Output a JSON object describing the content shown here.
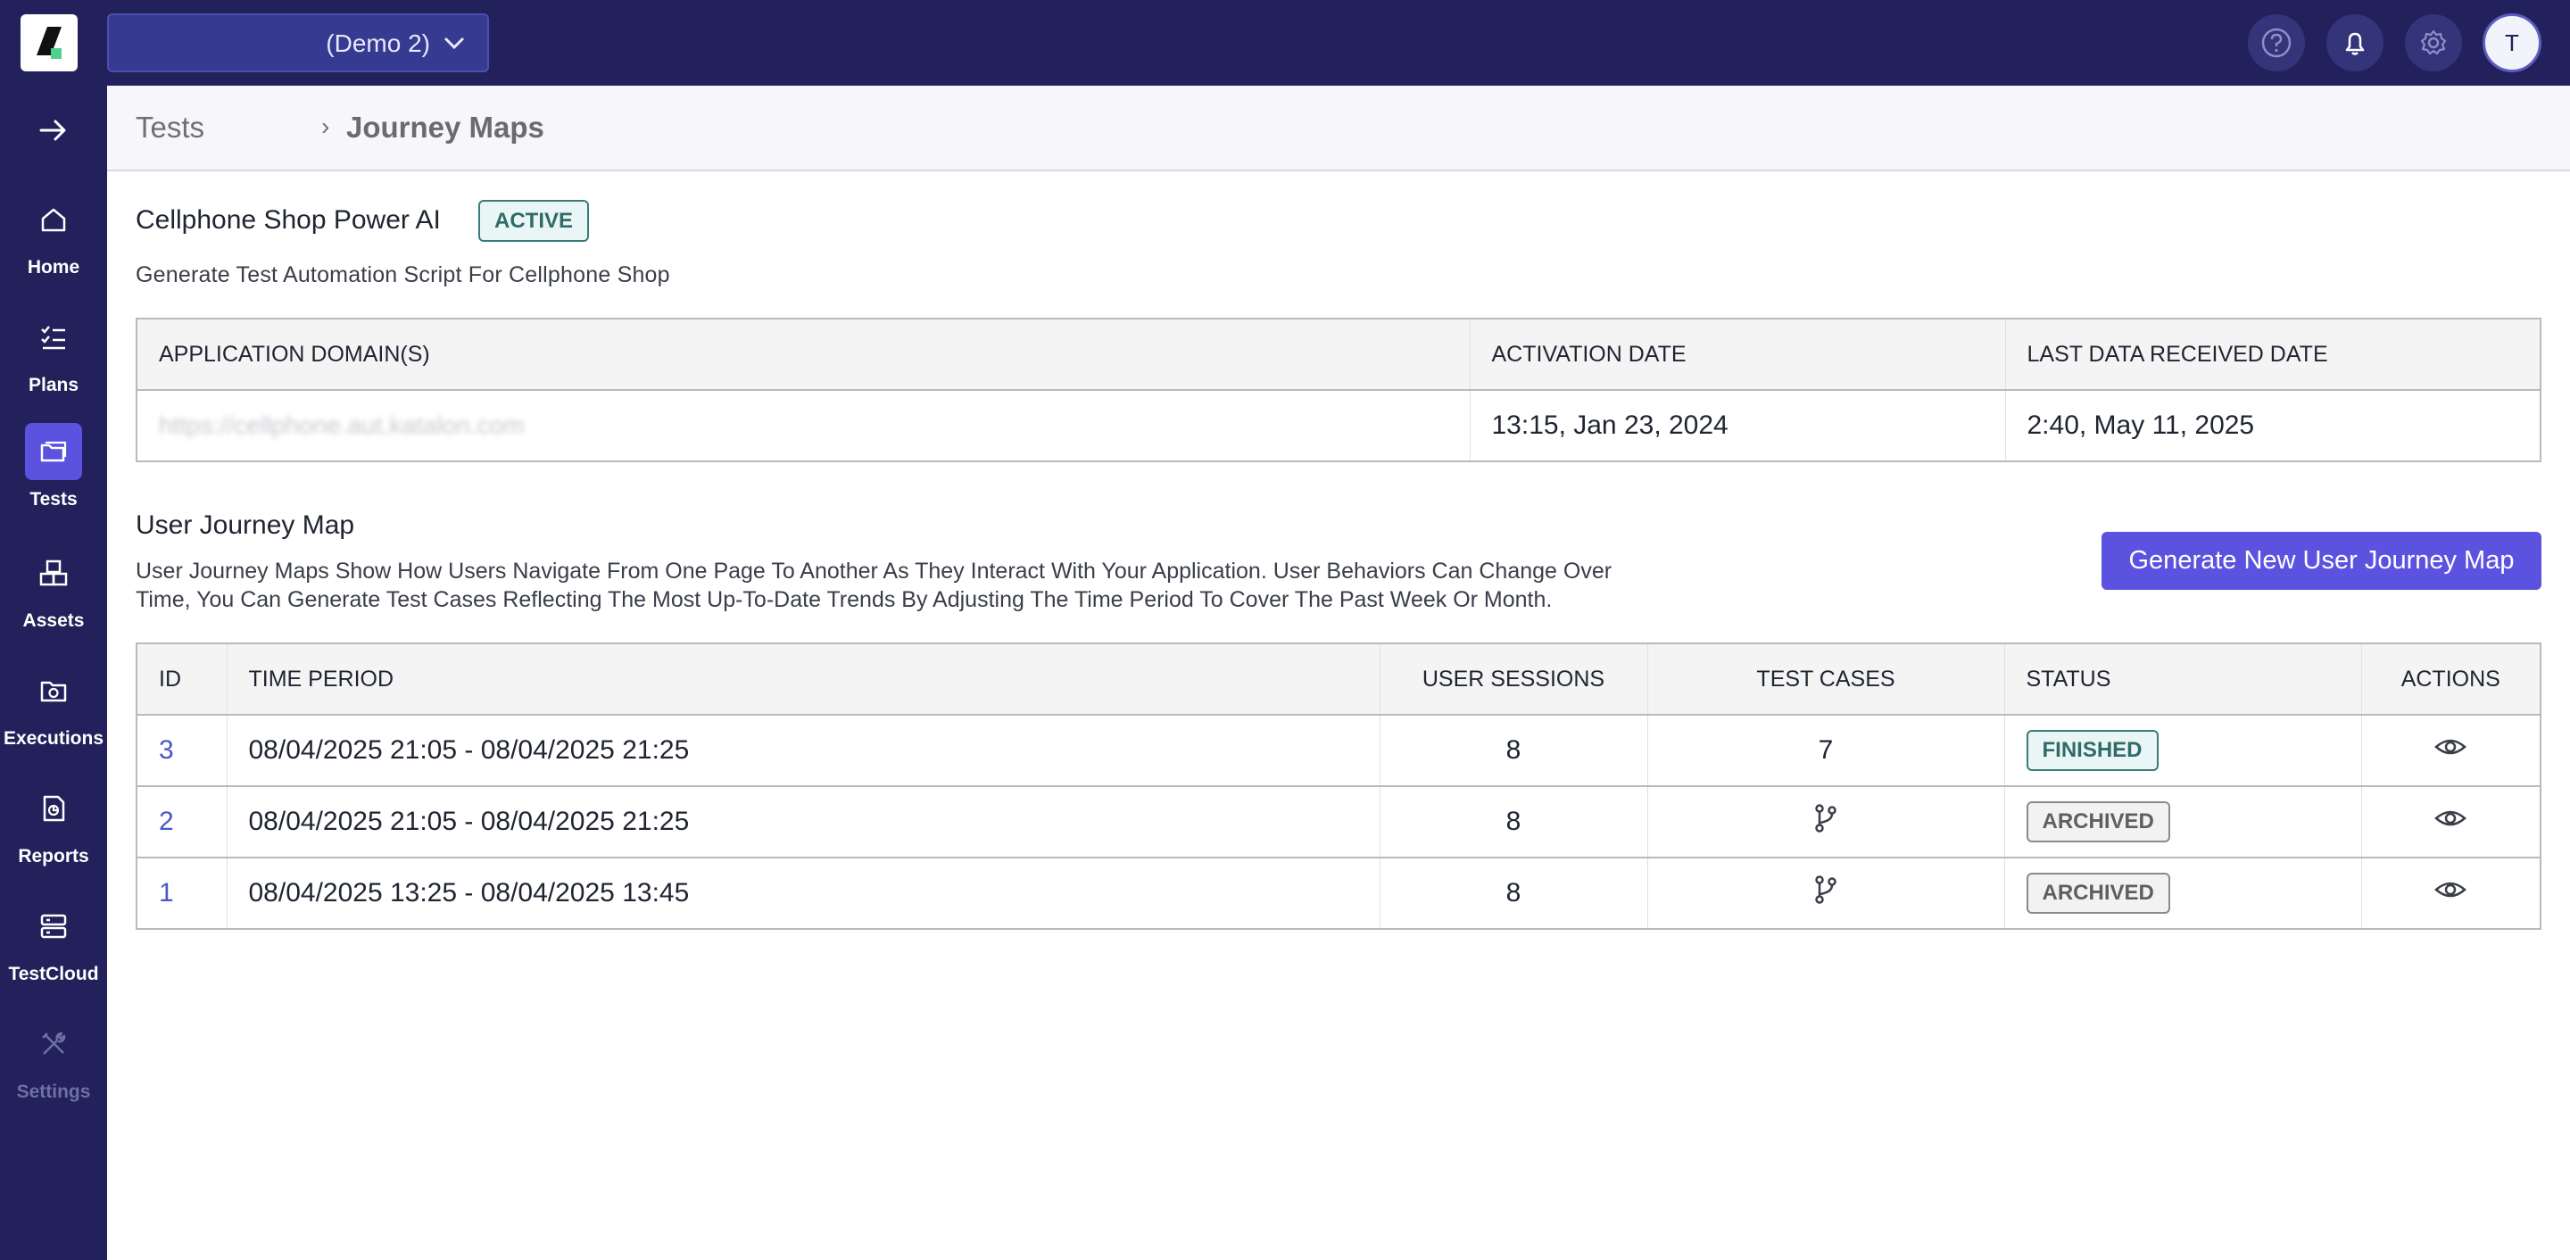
{
  "topbar": {
    "project_name": "(Demo 2)",
    "avatar_initial": "T",
    "icons": [
      "help-icon",
      "bell-icon",
      "gear-icon"
    ]
  },
  "sidebar": {
    "items": [
      {
        "label": "Home",
        "icon": "home-icon"
      },
      {
        "label": "Plans",
        "icon": "checklist-icon"
      },
      {
        "label": "Tests",
        "icon": "folder-icon",
        "active": true
      },
      {
        "label": "Assets",
        "icon": "boxes-icon"
      },
      {
        "label": "Executions",
        "icon": "execution-folder-icon"
      },
      {
        "label": "Reports",
        "icon": "report-icon"
      },
      {
        "label": "TestCloud",
        "icon": "server-icon"
      },
      {
        "label": "Settings",
        "icon": "tools-icon",
        "disabled": true
      }
    ]
  },
  "breadcrumb": {
    "root": "Tests",
    "separator": "›",
    "current": "Journey Maps"
  },
  "app": {
    "title": "Cellphone Shop Power AI",
    "status": "ACTIVE",
    "description": "Generate Test Automation Script For Cellphone Shop"
  },
  "domain_table": {
    "headers": [
      "APPLICATION DOMAIN(S)",
      "ACTIVATION DATE",
      "LAST DATA RECEIVED DATE"
    ],
    "row": {
      "domain": "https://cellphone.aut.katalon.com",
      "activation_date": "13:15, Jan 23, 2024",
      "last_data_date": "2:40, May 11, 2025"
    }
  },
  "journey": {
    "title": "User Journey Map",
    "description_line1": "User Journey Maps Show How Users Navigate From One Page To Another As They Interact With Your Application. User Behaviors Can Change Over",
    "description_line2": "Time, You Can Generate Test Cases Reflecting The Most Up-To-Date Trends By Adjusting The Time Period To Cover The Past Week Or Month.",
    "generate_button": "Generate New User Journey Map"
  },
  "journey_table": {
    "headers": [
      "ID",
      "TIME PERIOD",
      "USER SESSIONS",
      "TEST CASES",
      "STATUS",
      "ACTIONS"
    ],
    "rows": [
      {
        "id": "3",
        "period": "08/04/2025 21:05 - 08/04/2025 21:25",
        "sessions": "8",
        "test_cases": "7",
        "status": "FINISHED"
      },
      {
        "id": "2",
        "period": "08/04/2025 21:05 - 08/04/2025 21:25",
        "sessions": "8",
        "test_cases": "",
        "status": "ARCHIVED"
      },
      {
        "id": "1",
        "period": "08/04/2025 13:25 - 08/04/2025 13:45",
        "sessions": "8",
        "test_cases": "",
        "status": "ARCHIVED"
      }
    ]
  },
  "colors": {
    "topbar": "#22215b",
    "accent": "#5b53e0",
    "finished": "#2f6b69",
    "archived": "#5f5f63"
  }
}
